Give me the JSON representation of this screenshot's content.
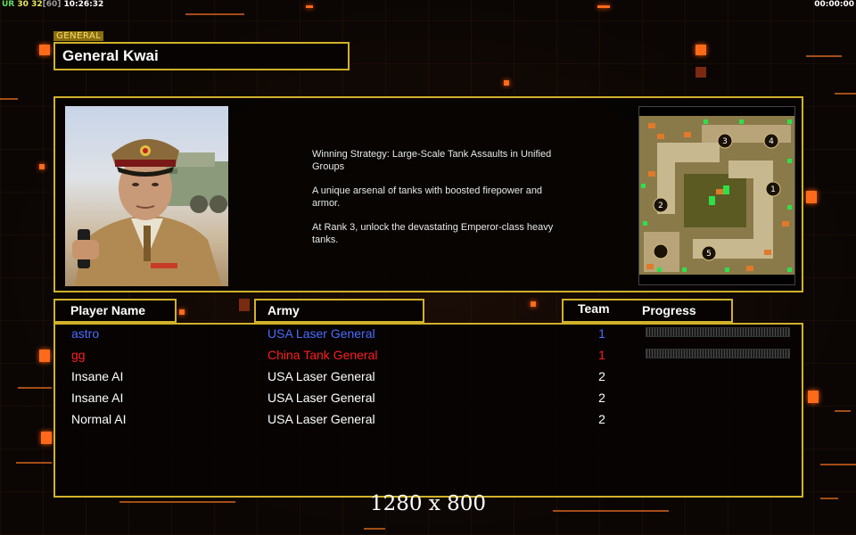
{
  "topbar": {
    "ur": "UR",
    "fps": "30",
    "fps2": "32",
    "fps_cap": "[60]",
    "time": "10:26:32",
    "game_clock": "00:00:00"
  },
  "general": {
    "tag": "GENERAL",
    "name": "General Kwai"
  },
  "description": {
    "lines": [
      "Winning Strategy: Large-Scale Tank Assaults in Unified Groups",
      "A unique arsenal of tanks with boosted firepower and armor.",
      "At Rank 3, unlock the devastating Emperor-class heavy tanks."
    ]
  },
  "columns": {
    "player": "Player Name",
    "army": "Army",
    "team": "Team",
    "progress": "Progress"
  },
  "players": [
    {
      "name": "astro",
      "army": "USA Laser General",
      "team": "1",
      "color": "#4a6cff",
      "progress_fraction": 0
    },
    {
      "name": "gg",
      "army": "China Tank General",
      "team": "1",
      "color": "#ff1e1e",
      "progress_fraction": 0
    },
    {
      "name": "Insane AI",
      "army": "USA Laser General",
      "team": "2",
      "color": "#ffffff"
    },
    {
      "name": "Insane AI",
      "army": "USA Laser General",
      "team": "2",
      "color": "#ffffff"
    },
    {
      "name": "Normal AI",
      "army": "USA Laser General",
      "team": "2",
      "color": "#ffffff"
    }
  ],
  "minimap": {
    "start_positions": [
      "1",
      "2",
      "3",
      "4",
      "5"
    ]
  },
  "resolution": "1280 x 800",
  "colors": {
    "border": "#d2b12a",
    "accent": "#ff6a1a"
  }
}
